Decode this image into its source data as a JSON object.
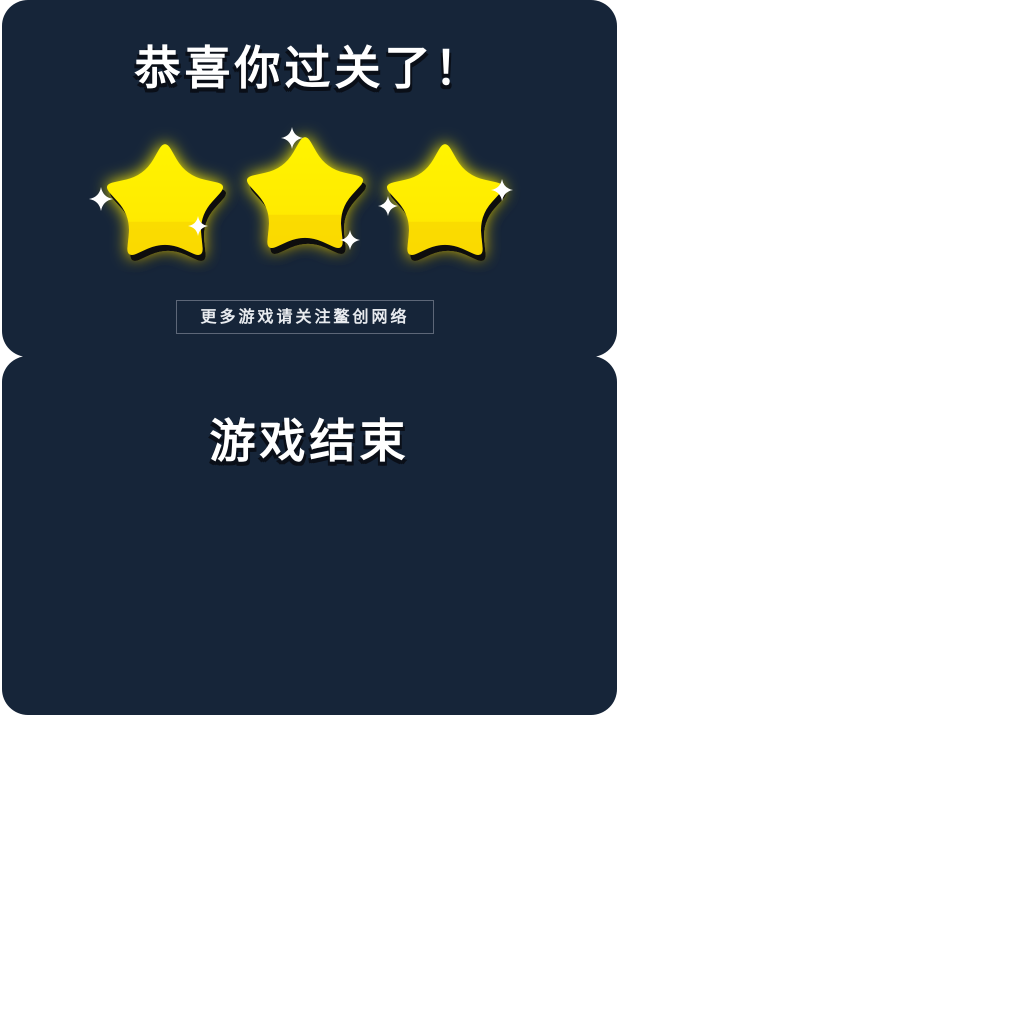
{
  "win_panel": {
    "title": "恭喜你过关了！",
    "stars_earned": 3,
    "stars_total": 3,
    "star_color": "#fff200",
    "star_shadow_color": "#0c0c0c",
    "follow_text": "更多游戏请关注鳌创网络"
  },
  "game_over_panel": {
    "title": "游戏结束"
  },
  "colors": {
    "panel_background": "#162539",
    "page_background": "#ffffff",
    "title_text": "#ffffff"
  }
}
